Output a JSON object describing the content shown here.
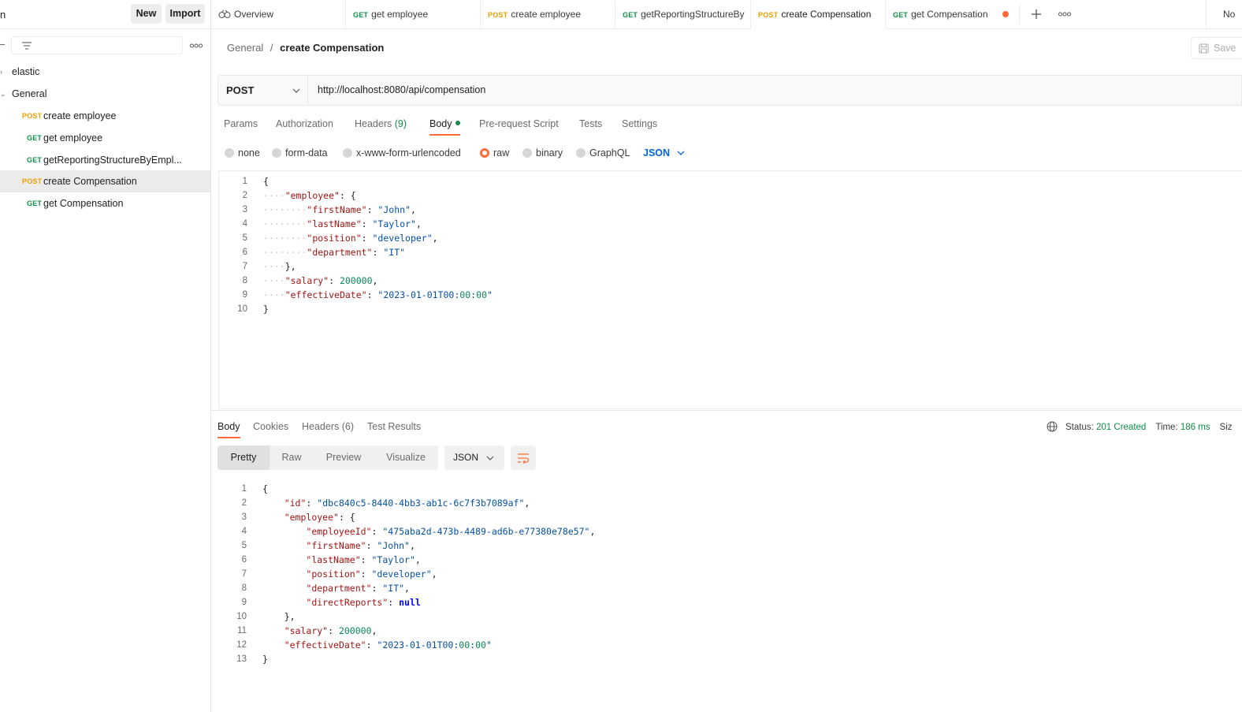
{
  "sidebar": {
    "header_fragment": "n",
    "new_label": "New",
    "import_label": "Import",
    "tree": [
      {
        "label": "elastic",
        "method": "",
        "type": "folder",
        "expanded": false
      },
      {
        "label": "General",
        "method": "",
        "type": "folder",
        "expanded": true
      },
      {
        "label": "create employee",
        "method": "POST",
        "type": "request"
      },
      {
        "label": "get employee",
        "method": "GET",
        "type": "request"
      },
      {
        "label": "getReportingStructureByEmpl...",
        "method": "GET",
        "type": "request"
      },
      {
        "label": "create Compensation",
        "method": "POST",
        "type": "request",
        "active": true
      },
      {
        "label": "get Compensation",
        "method": "GET",
        "type": "request"
      }
    ]
  },
  "tabs": [
    {
      "method": "",
      "label": "Overview"
    },
    {
      "method": "GET",
      "label": "get employee"
    },
    {
      "method": "POST",
      "label": "create employee"
    },
    {
      "method": "GET",
      "label": "getReportingStructureBy"
    },
    {
      "method": "POST",
      "label": "create Compensation",
      "active": true
    },
    {
      "method": "GET",
      "label": "get Compensation",
      "unsaved": true
    }
  ],
  "tabbar_right_fragment": "No",
  "breadcrumb": {
    "parent": "General",
    "separator": "/",
    "current": "create Compensation"
  },
  "save_label": "Save",
  "request": {
    "method": "POST",
    "url": "http://localhost:8080/api/compensation",
    "tabs": [
      {
        "label": "Params"
      },
      {
        "label": "Authorization"
      },
      {
        "label": "Headers",
        "count": "(9)"
      },
      {
        "label": "Body",
        "active": true
      },
      {
        "label": "Pre-request Script"
      },
      {
        "label": "Tests"
      },
      {
        "label": "Settings"
      }
    ],
    "body_types": [
      "none",
      "form-data",
      "x-www-form-urlencoded",
      "raw",
      "binary",
      "GraphQL"
    ],
    "selected_body_type": "raw",
    "format": "JSON",
    "body_lines": [
      "{",
      "    \"employee\": {",
      "        \"firstName\": \"John\",",
      "        \"lastName\": \"Taylor\",",
      "        \"position\": \"developer\",",
      "        \"department\": \"IT\"",
      "    },",
      "    \"salary\": 200000,",
      "    \"effectiveDate\": \"2023-01-01T00:00:00\"",
      "}"
    ]
  },
  "response": {
    "tabs": [
      {
        "label": "Body",
        "active": true
      },
      {
        "label": "Cookies"
      },
      {
        "label": "Headers",
        "count": "(6)"
      },
      {
        "label": "Test Results"
      }
    ],
    "status_label": "Status:",
    "status_value": "201 Created",
    "time_label": "Time:",
    "time_value": "186 ms",
    "size_fragment": "Siz",
    "views": [
      "Pretty",
      "Raw",
      "Preview",
      "Visualize"
    ],
    "format": "JSON",
    "body_lines": [
      "{",
      "    \"id\": \"dbc840c5-8440-4bb3-ab1c-6c7f3b7089af\",",
      "    \"employee\": {",
      "        \"employeeId\": \"475aba2d-473b-4489-ad6b-e77380e78e57\",",
      "        \"firstName\": \"John\",",
      "        \"lastName\": \"Taylor\",",
      "        \"position\": \"developer\",",
      "        \"department\": \"IT\",",
      "        \"directReports\": null",
      "    },",
      "    \"salary\": 200000,",
      "    \"effectiveDate\": \"2023-01-01T00:00:00\"",
      "}"
    ]
  },
  "colors": {
    "accent": "#ff6c37",
    "get": "#0f8f48",
    "post": "#e8a100",
    "key": "#a31515",
    "string": "#0451a5",
    "number": "#098658"
  }
}
